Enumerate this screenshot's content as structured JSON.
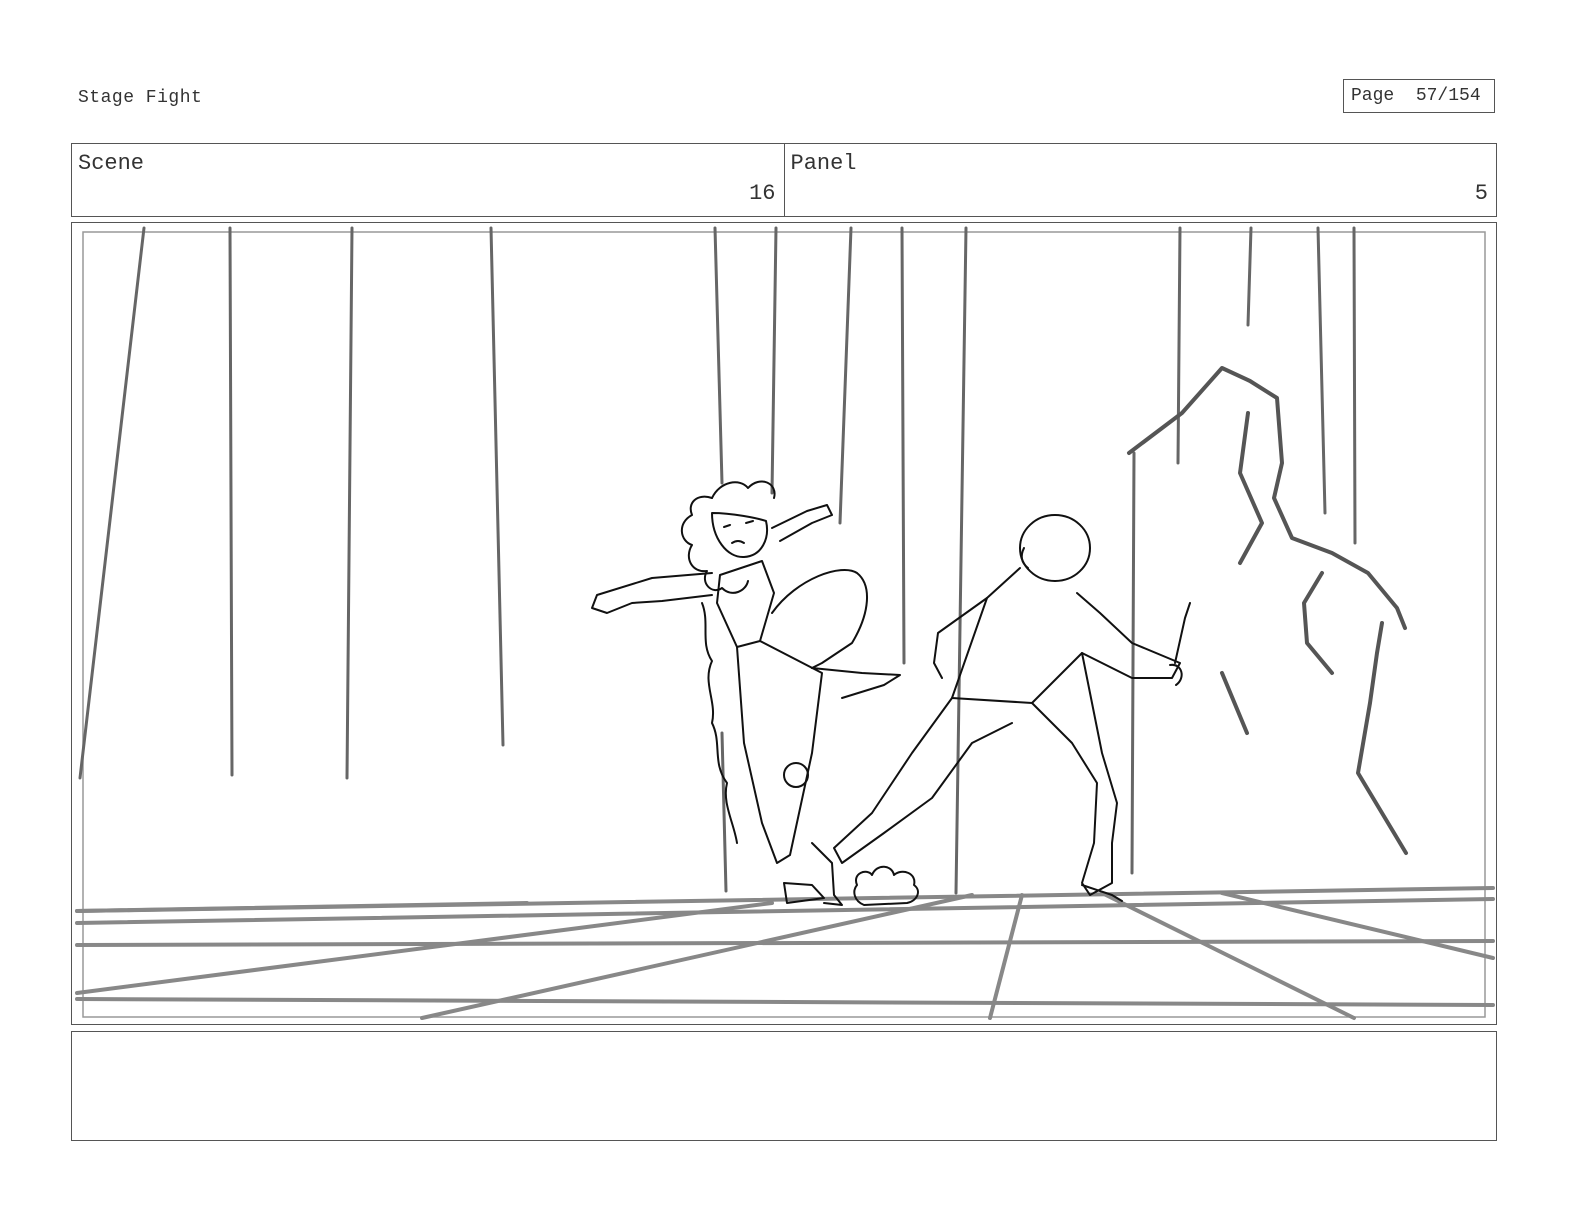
{
  "header": {
    "title": "Stage Fight",
    "page_label": "Page",
    "page_number": "57/154"
  },
  "info": {
    "scene_label": "Scene",
    "scene_value": "16",
    "panel_label": "Panel",
    "panel_value": "5"
  },
  "artwork": {
    "description_icon": "storyboard-sketch-image"
  },
  "notes": {
    "text": ""
  }
}
